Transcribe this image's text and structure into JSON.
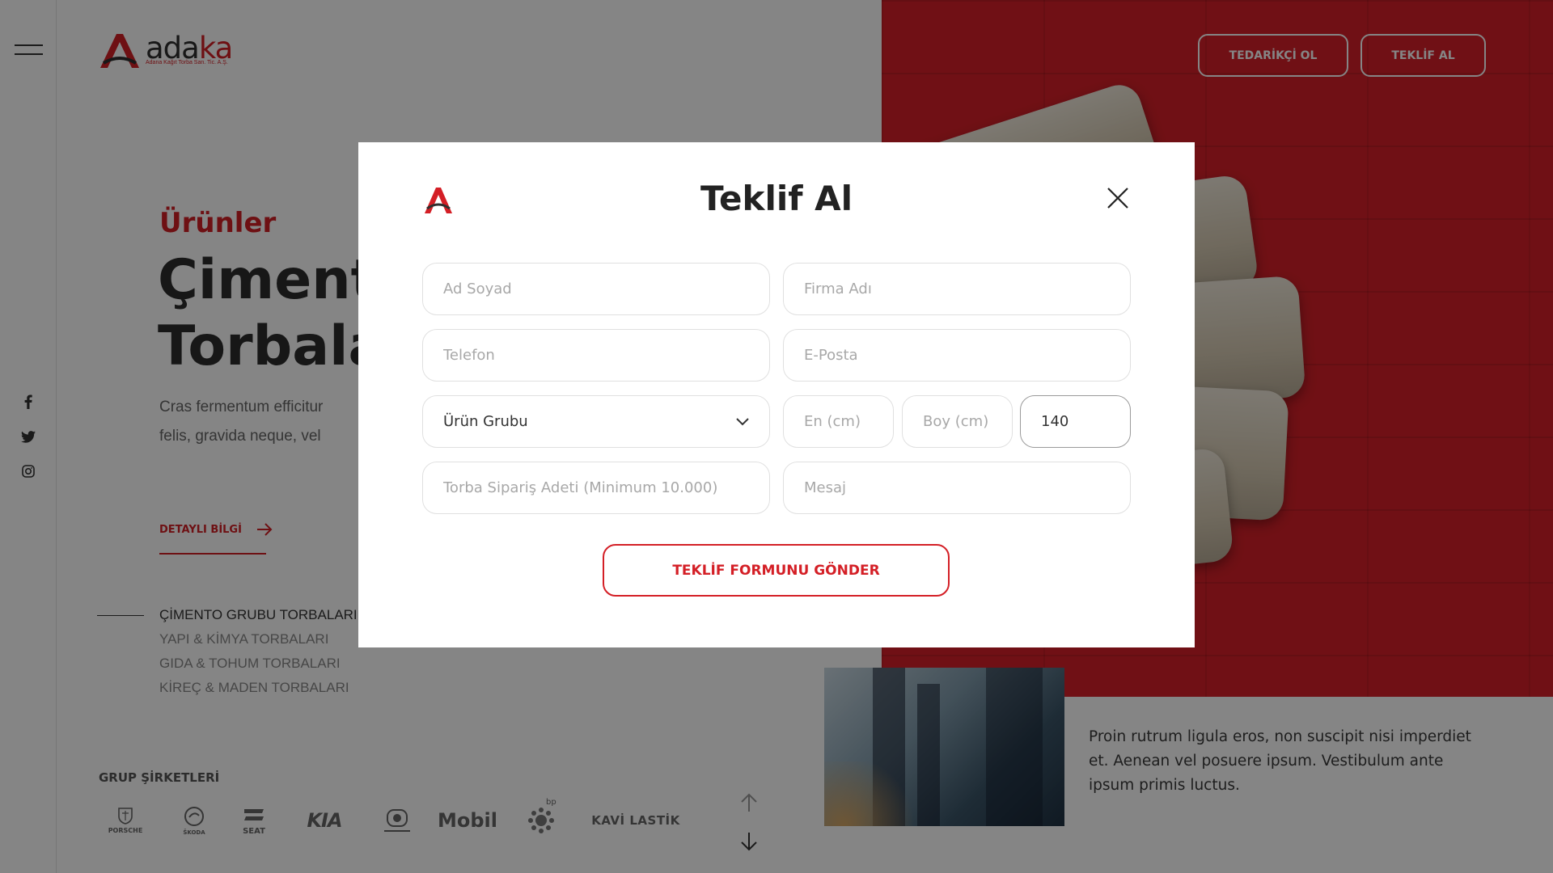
{
  "header": {
    "logo_text_main": "ada",
    "logo_text_accent": "ka",
    "logo_subtitle": "Adana Kağıt Torba San. Tic. A.Ş.",
    "btn_supplier": "TEDARİKÇİ OL",
    "btn_quote": "TEKLİF AL"
  },
  "sidebar": {
    "social": [
      "facebook-icon",
      "twitter-icon",
      "instagram-icon"
    ]
  },
  "hero": {
    "eyebrow": "Ürünler",
    "title": "Çimento\nTorbaları",
    "description": "Cras fermentum efficitur felis, gravida neque, vel lacinia ne",
    "more_link": "DETAYLI BİLGİ",
    "categories": [
      "ÇİMENTO GRUBU TORBALARI",
      "YAPI & KİMYA TORBALARI",
      "GIDA & TOHUM TORBALARI",
      "KİREÇ & MADEN TORBALARI"
    ]
  },
  "group": {
    "label": "GRUP ŞİRKETLERİ",
    "brands": [
      "PORSCHE",
      "ŠKODA",
      "SEAT",
      "KIA",
      "",
      "Mobil",
      "bp",
      "KAVİ LASTİK"
    ]
  },
  "side_text": "Proin rutrum ligula eros, non suscipit nisi imperdiet et. Aenean vel posuere ipsum. Vestibulum ante ipsum primis luctus.",
  "modal": {
    "title": "Teklif Al",
    "fields": {
      "name_placeholder": "Ad Soyad",
      "company_placeholder": "Firma Adı",
      "phone_placeholder": "Telefon",
      "email_placeholder": "E-Posta",
      "product_group_value": "Ürün Grubu",
      "width_placeholder": "En (cm)",
      "height_placeholder": "Boy (cm)",
      "gusset_value": "140",
      "quantity_placeholder": "Torba Sipariş Adeti (Minimum 10.000)",
      "message_placeholder": "Mesaj"
    },
    "submit_label": "TEKLİF FORMUNU GÖNDER"
  },
  "colors": {
    "brand_red": "#d41f26",
    "overlay": "rgba(0,0,0,0.48)"
  }
}
